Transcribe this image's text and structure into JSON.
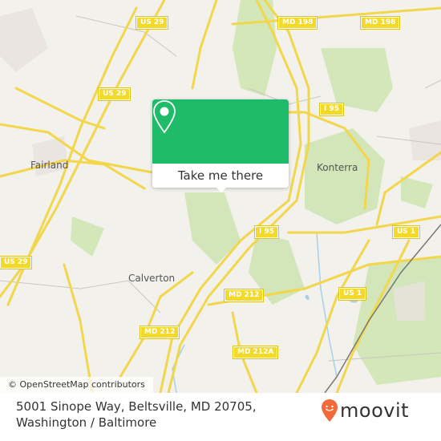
{
  "map": {
    "place_labels": [
      {
        "id": "fairland",
        "text": "Fairland"
      },
      {
        "id": "konterra",
        "text": "Konterra"
      },
      {
        "id": "calverton",
        "text": "Calverton"
      }
    ],
    "road_shields": [
      {
        "id": "us29-top",
        "text": "US 29"
      },
      {
        "id": "us29-mid",
        "text": "US 29"
      },
      {
        "id": "us29-left",
        "text": "US 29"
      },
      {
        "id": "md198-left",
        "text": "MD 198"
      },
      {
        "id": "md198-right",
        "text": "MD 198"
      },
      {
        "id": "i95-top",
        "text": "I 95"
      },
      {
        "id": "i95-mid",
        "text": "I 95"
      },
      {
        "id": "us1-top",
        "text": "US 1"
      },
      {
        "id": "us1-mid",
        "text": "US 1"
      },
      {
        "id": "md212-left",
        "text": "MD 212"
      },
      {
        "id": "md212-mid",
        "text": "MD 212"
      },
      {
        "id": "md212a",
        "text": "MD 212A"
      }
    ],
    "attribution": "© OpenStreetMap contributors"
  },
  "popup": {
    "icon": "map-pin-icon",
    "button_label": "Take me there",
    "color": "#1ebb69"
  },
  "footer": {
    "address": "5001 Sinope Way, Beltsville, MD 20705, Washington / Baltimore",
    "logo_text": "moovit",
    "logo_color": "#f26a3a"
  }
}
